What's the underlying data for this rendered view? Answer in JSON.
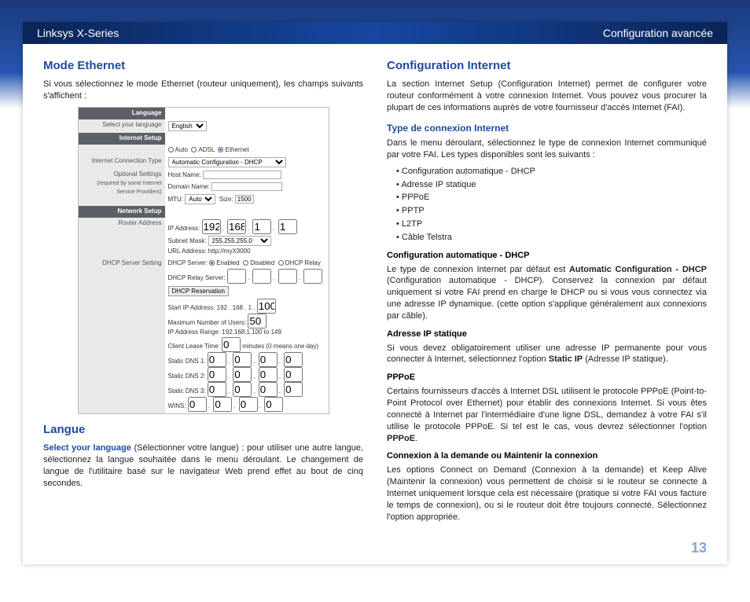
{
  "header": {
    "left": "Linksys X-Series",
    "right": "Configuration avancée"
  },
  "pagenum": "13",
  "left": {
    "h_ethernet": "Mode Ethernet",
    "p_ethernet": "Si vous sélectionnez le mode Ethernet (routeur uniquement), les champs suivants s'affichent :",
    "h_langue": "Langue",
    "langue_lead": "Select your language",
    "langue_rest": " (Sélectionner votre langue) : pour utiliser une autre langue, sélectionnez la langue souhaitée dans le menu déroulant. Le changement de langue de l'utilitaire basé sur le navigateur Web prend effet au bout de cinq secondes."
  },
  "shot": {
    "sec_language": "Language",
    "row_sel_lang": "Select your language",
    "val_english": "English",
    "sec_internet": "Internet Setup",
    "row_mode_auto": "Auto",
    "row_mode_adsl": "ADSL",
    "row_mode_eth": "Ethernet",
    "row_ict": "Internet Connection Type",
    "val_ict": "Automatic Configuration - DHCP",
    "row_optset": "Optional Settings",
    "row_optset2": "(required by some Internet Service Providers)",
    "row_host": "Host Name:",
    "row_domain": "Domain Name:",
    "row_mtu": "MTU:",
    "val_mtu_auto": "Auto",
    "val_mtu_size": "Size:",
    "val_mtu_sizeval": "1500",
    "sec_network": "Network Setup",
    "row_router": "Router Address",
    "row_ip": "IP Address:",
    "ip": [
      "192",
      "168",
      "1",
      "1"
    ],
    "row_subnet": "Subnet Mask:",
    "val_subnet": "255.255.255.0",
    "row_url": "URL Address:",
    "val_url": "http://myX3000",
    "row_dhcpset": "DHCP Server Setting",
    "row_dhcpsrv": "DHCP Server:",
    "dhcp_enabled": "Enabled",
    "dhcp_disabled": "Disabled",
    "dhcp_relay": "DHCP Relay",
    "row_dhcp_relaysrv": "DHCP Relay Server:",
    "btn_dhcp_res": "DHCP Reservation",
    "row_startip": "Start IP Address:",
    "val_startip_pre": "192 . 168 . 1 .",
    "val_startip_last": "100",
    "row_maxusers": "Maximum Number of Users:",
    "val_maxusers": "50",
    "row_iprange": "IP Address Range:",
    "val_iprange": "192.168.1.100 to 149",
    "row_lease": "Client Lease Time:",
    "val_lease": "0",
    "val_lease_note": "minutes (0 means one day)",
    "row_dns1": "Static DNS 1:",
    "row_dns2": "Static DNS 2:",
    "row_dns3": "Static DNS 3:",
    "row_wins": "WINS:",
    "zeros": [
      "0",
      "0",
      "0",
      "0"
    ]
  },
  "right": {
    "h_conf": "Configuration Internet",
    "p_conf": "La section Internet Setup (Configuration Internet) permet de configurer votre routeur conformément à votre connexion Internet. Vous pouvez vous procurer la plupart de ces informations auprès de votre fournisseur d'accès Internet (FAI).",
    "h_type": "Type de connexion Internet",
    "p_type": "Dans le menu déroulant, sélectionnez le type de connexion Internet communiqué par votre FAI. Les types disponibles sont les suivants :",
    "types": [
      "Configuration automatique - DHCP",
      "Adresse IP statique",
      "PPPoE",
      "PPTP",
      "L2TP",
      "Câble Telstra"
    ],
    "h_dhcp": "Configuration automatique - DHCP",
    "p_dhcp_a": "Le type de connexion Internet par défaut est ",
    "p_dhcp_b": "Automatic Configuration - DHCP",
    "p_dhcp_c": " (Configuration automatique - DHCP). Conservez la connexion par défaut uniquement si votre FAI prend en charge le DHCP ou si vous vous connectez via une adresse IP dynamique. (cette option s'applique généralement aux connexions par câble).",
    "h_static": "Adresse IP statique",
    "p_static_a": "Si vous devez obligatoirement utiliser une adresse IP permanente pour vous connecter à Internet, sélectionnez l'option ",
    "p_static_b": "Static IP",
    "p_static_c": " (Adresse IP statique).",
    "h_pppoe": "PPPoE",
    "p_pppoe_a": "Certains fournisseurs d'accès à Internet DSL utilisent le protocole PPPoE (Point-to-Point Protocol over Ethernet) pour établir des connexions Internet. Si vous êtes connecté à Internet par l'intermédiaire d'une ligne DSL, demandez à votre FAI s'il utilise le protocole PPPoE. Si tel est le cas, vous devrez sélectionner l'option ",
    "p_pppoe_b": "PPPoE",
    "p_pppoe_c": ".",
    "h_conn": "Connexion à la demande ou Maintenir la connexion",
    "p_conn": "Les options Connect on Demand (Connexion à la demande) et Keep Alive (Maintenir la connexion) vous permettent de choisir si le routeur se connecte à Internet uniquement lorsque cela est nécessaire (pratique si votre FAI vous facture le temps de connexion), ou si le routeur doit être toujours connecté. Sélectionnez l'option appropriée."
  }
}
